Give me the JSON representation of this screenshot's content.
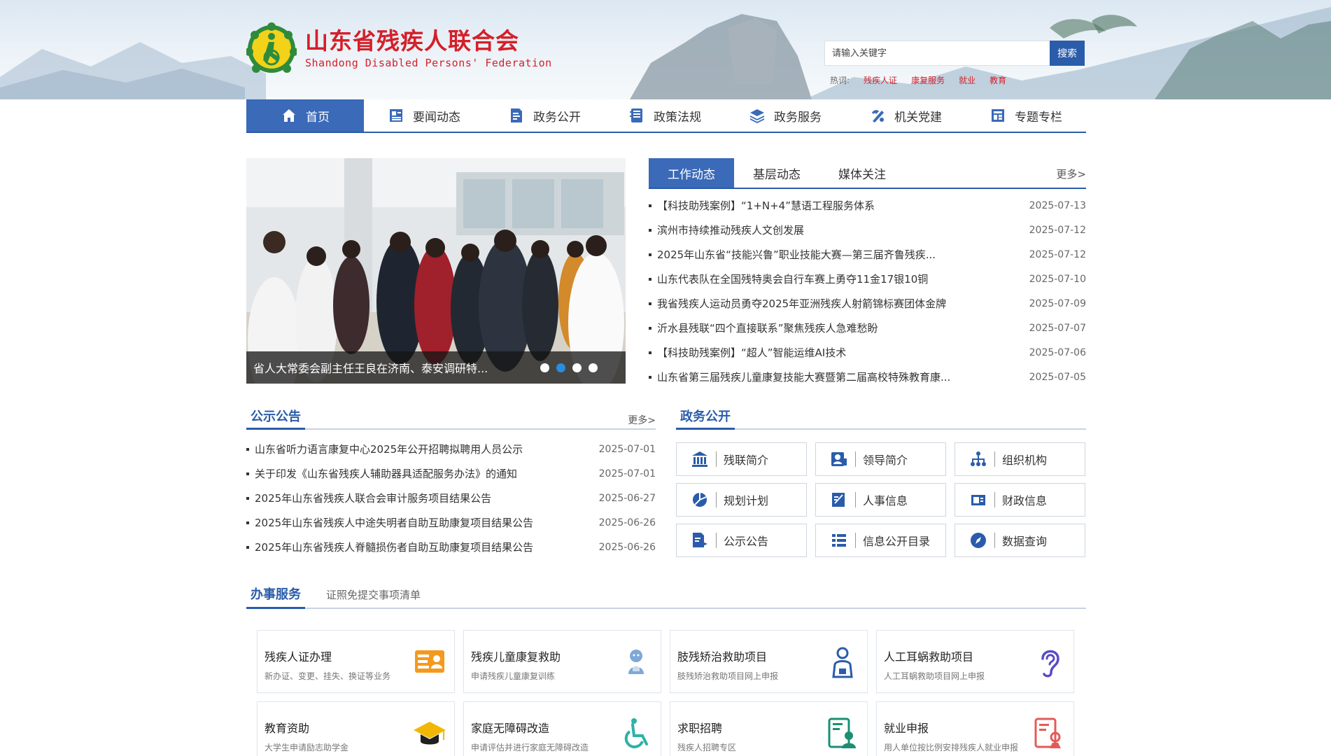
{
  "header": {
    "org_cn": "山东省残疾人联合会",
    "org_en": "Shandong Disabled Persons' Federation",
    "search_placeholder": "请输入关键字",
    "search_button": "搜索",
    "hot_label": "热词:",
    "hot_words": [
      "残疾人证",
      "康复服务",
      "就业",
      "教育"
    ]
  },
  "nav": [
    {
      "label": "首页",
      "icon": "home-icon"
    },
    {
      "label": "要闻动态",
      "icon": "news-icon"
    },
    {
      "label": "政务公开",
      "icon": "document-icon"
    },
    {
      "label": "政策法规",
      "icon": "book-icon"
    },
    {
      "label": "政务服务",
      "icon": "layers-icon"
    },
    {
      "label": "机关党建",
      "icon": "party-icon"
    },
    {
      "label": "专题专栏",
      "icon": "column-icon"
    }
  ],
  "carousel": {
    "caption": "省人大常委会副主任王良在济南、泰安调研特...",
    "slides": 4,
    "active": 2
  },
  "news": {
    "tabs": [
      "工作动态",
      "基层动态",
      "媒体关注"
    ],
    "more": "更多>",
    "items": [
      {
        "title": "【科技助残案例】“1+N+4”慧语工程服务体系",
        "date": "2025-07-13"
      },
      {
        "title": "滨州市持续推动残疾人文创发展",
        "date": "2025-07-12"
      },
      {
        "title": "2025年山东省“技能兴鲁”职业技能大赛—第三届齐鲁残疾...",
        "date": "2025-07-12"
      },
      {
        "title": "山东代表队在全国残特奥会自行车赛上勇夺11金17银10铜",
        "date": "2025-07-10"
      },
      {
        "title": "我省残疾人运动员勇夺2025年亚洲残疾人射箭锦标赛团体金牌",
        "date": "2025-07-09"
      },
      {
        "title": "沂水县残联“四个直接联系”聚焦残疾人急难愁盼",
        "date": "2025-07-07"
      },
      {
        "title": "【科技助残案例】“超人”智能运维AI技术",
        "date": "2025-07-06"
      },
      {
        "title": "山东省第三届残疾儿童康复技能大赛暨第二届高校特殊教育康...",
        "date": "2025-07-05"
      }
    ]
  },
  "notice": {
    "title": "公示公告",
    "more": "更多>",
    "items": [
      {
        "title": "山东省听力语言康复中心2025年公开招聘拟聘用人员公示",
        "date": "2025-07-01"
      },
      {
        "title": "关于印发《山东省残疾人辅助器具适配服务办法》的通知",
        "date": "2025-07-01"
      },
      {
        "title": "2025年山东省残疾人联合会审计服务项目结果公告",
        "date": "2025-06-27"
      },
      {
        "title": "2025年山东省残疾人中途失明者自助互助康复项目结果公告",
        "date": "2025-06-26"
      },
      {
        "title": "2025年山东省残疾人脊髓损伤者自助互助康复项目结果公告",
        "date": "2025-06-26"
      }
    ]
  },
  "gov": {
    "title": "政务公开",
    "items": [
      {
        "label": "残联简介",
        "icon": "building-icon"
      },
      {
        "label": "领导简介",
        "icon": "leader-icon"
      },
      {
        "label": "组织机构",
        "icon": "org-chart-icon"
      },
      {
        "label": "规划计划",
        "icon": "plan-icon"
      },
      {
        "label": "人事信息",
        "icon": "personnel-icon"
      },
      {
        "label": "财政信息",
        "icon": "finance-icon"
      },
      {
        "label": "公示公告",
        "icon": "notice-icon"
      },
      {
        "label": "信息公开目录",
        "icon": "catalog-icon"
      },
      {
        "label": "数据查询",
        "icon": "compass-icon"
      }
    ]
  },
  "services": {
    "tab_active": "办事服务",
    "tab_other": "证照免提交事项清单",
    "items": [
      {
        "name": "残疾人证办理",
        "desc": "新办证、变更、挂失、换证等业务",
        "icon": "id-card-icon"
      },
      {
        "name": "残疾儿童康复救助",
        "desc": "申请残疾儿童康复训练",
        "icon": "child-icon"
      },
      {
        "name": "肢残矫治救助项目",
        "desc": "肢残矫治救助项目网上申报",
        "icon": "person-icon"
      },
      {
        "name": "人工耳蜗救助项目",
        "desc": "人工耳蜗救助项目网上申报",
        "icon": "ear-icon"
      },
      {
        "name": "教育资助",
        "desc": "大学生申请励志助学金",
        "icon": "graduation-cap-icon"
      },
      {
        "name": "家庭无障碍改造",
        "desc": "申请评估并进行家庭无障碍改造",
        "icon": "wheelchair-icon"
      },
      {
        "name": "求职招聘",
        "desc": "残疾人招聘专区",
        "icon": "resume-icon"
      },
      {
        "name": "就业申报",
        "desc": "用人单位按比例安排残疾人就业申报",
        "icon": "report-icon"
      }
    ]
  },
  "colors": {
    "primary": "#2a5caa",
    "brand_red": "#d4202a",
    "orange": "#f39a1e"
  }
}
